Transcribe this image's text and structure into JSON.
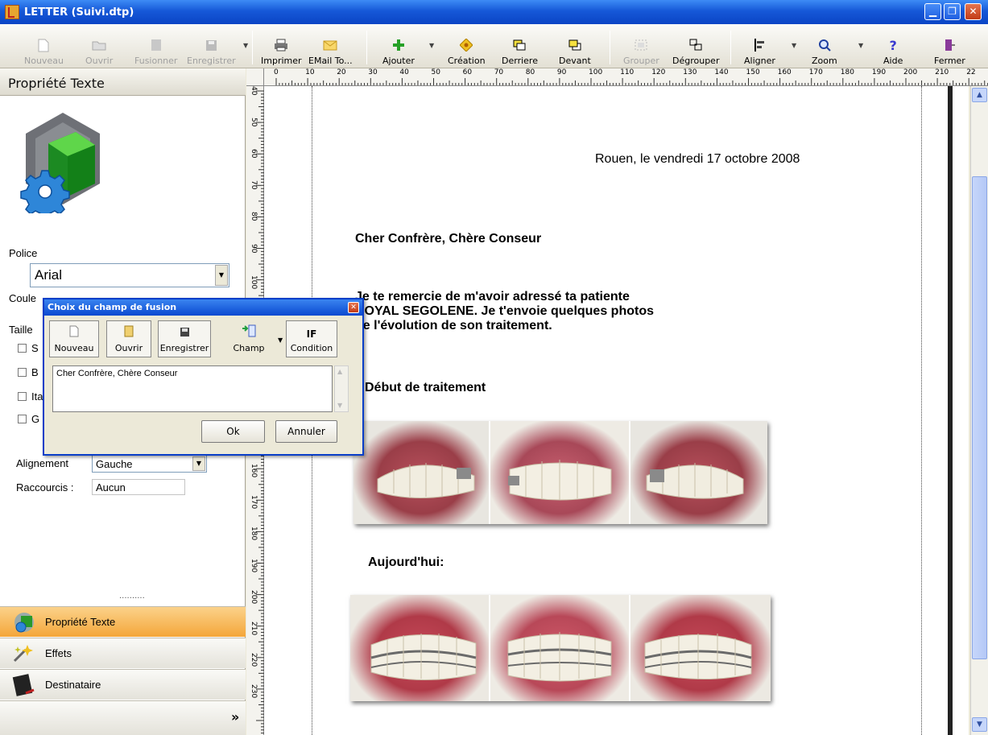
{
  "window": {
    "title": "LETTER (Suivi.dtp)"
  },
  "toolbar": {
    "nouveau": "Nouveau",
    "ouvrir": "Ouvrir",
    "fusionner": "Fusionner",
    "enregistrer": "Enregistrer",
    "imprimer": "Imprimer",
    "email": "EMail To...",
    "ajouter": "Ajouter",
    "creation": "Création",
    "derriere": "Derriere",
    "devant": "Devant",
    "grouper": "Grouper",
    "degrouper": "Dégrouper",
    "aligner": "Aligner",
    "zoom": "Zoom",
    "aide": "Aide",
    "fermer": "Fermer"
  },
  "panel": {
    "title": "Propriété Texte",
    "police_label": "Police",
    "police_value": "Arial",
    "couleur_label": "Coule",
    "taille_label": "Taille",
    "check_labels": [
      "S",
      "B",
      "Ita",
      "G"
    ],
    "alignement_label": "Alignement",
    "alignement_value": "Gauche",
    "raccourcis_label": "Raccourcis :",
    "raccourcis_value": "Aucun",
    "grip": "..........",
    "nav": [
      "Propriété Texte",
      "Effets",
      "Destinataire"
    ],
    "more": "»"
  },
  "ruler": {
    "unit": "mm",
    "h_labels": [
      "0",
      "10",
      "20",
      "30",
      "40",
      "50",
      "60",
      "70",
      "80",
      "90",
      "100",
      "110",
      "120",
      "130",
      "140",
      "150",
      "160",
      "170",
      "180",
      "190",
      "200",
      "210",
      "22"
    ],
    "v_labels": [
      "40",
      "50",
      "60",
      "70",
      "80",
      "90",
      "100",
      "110",
      "120",
      "130",
      "140",
      "150",
      "160",
      "170",
      "180",
      "190",
      "200",
      "210",
      "220",
      "230"
    ]
  },
  "letter": {
    "date": "Rouen, le vendredi 17 octobre 2008",
    "greeting": "Cher Confrère, Chère Conseur",
    "body_line1": "Je te remercie de m'avoir adressé ta patiente",
    "body_line2": "ROYAL SEGOLENE. Je t'envoie quelques photos",
    "body_line3": "de l'évolution de son traitement.",
    "section1": "Début de traitement",
    "section2": "Aujourd'hui:"
  },
  "dialog": {
    "title": "Choix du champ de fusion",
    "nouveau": "Nouveau",
    "ouvrir": "Ouvrir",
    "enregistrer": "Enregistrer",
    "champ": "Champ",
    "condition_icon": "IF",
    "condition": "Condition",
    "text": "Cher Confrère, Chère Conseur",
    "ok": "Ok",
    "annuler": "Annuler"
  },
  "colors": {
    "accent": "#0a46c8",
    "nav_active": "#f6b24a",
    "teeth": "#f1ede0",
    "gum": "#d87a88"
  }
}
